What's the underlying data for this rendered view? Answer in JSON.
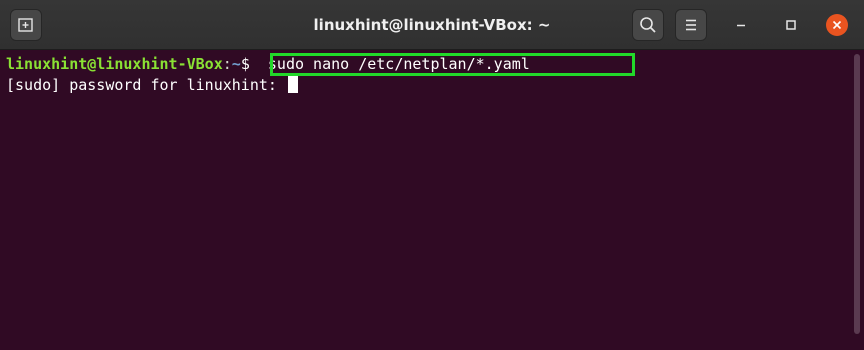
{
  "window": {
    "title": "linuxhint@linuxhint-VBox: ~"
  },
  "titlebar": {
    "icons": {
      "new_tab": "new-tab-icon",
      "search": "search-icon",
      "menu": "hamburger-menu-icon",
      "minimize": "minimize-icon",
      "maximize": "maximize-icon",
      "close": "close-icon"
    }
  },
  "terminal": {
    "prompt_user": "linuxhint@linuxhint-VBox",
    "prompt_sep": ":",
    "prompt_path": "~",
    "prompt_symbol": "$",
    "command": "  sudo nano /etc/netplan/*.yaml",
    "password_prompt": "[sudo] password for linuxhint: "
  },
  "colors": {
    "terminal_bg": "#300a24",
    "prompt_user": "#8ae234",
    "prompt_path": "#729fcf",
    "highlight": "#22d82a",
    "close_button": "#e95420"
  }
}
